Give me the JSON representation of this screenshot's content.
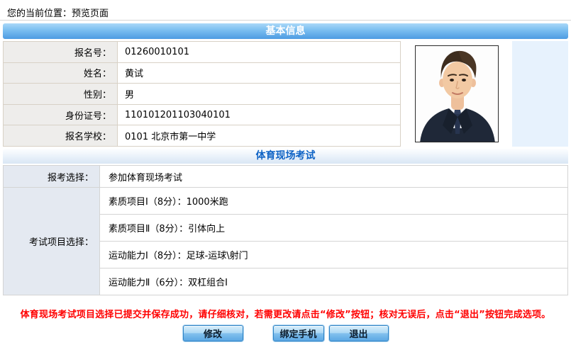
{
  "breadcrumb": {
    "text": "您的当前位置：预览页面"
  },
  "basic_info": {
    "header": "基本信息",
    "rows": [
      {
        "label": "报名号：",
        "value": "01260010101"
      },
      {
        "label": "姓名：",
        "value": "黄试"
      },
      {
        "label": "性别：",
        "value": "男"
      },
      {
        "label": "身份证号：",
        "value": "110101201103040101"
      },
      {
        "label": "报名学校：",
        "value": "0101 北京市第一中学"
      }
    ]
  },
  "exam": {
    "header": "体育现场考试",
    "choice_label": "报考选择：",
    "choice_value": "参加体育现场考试",
    "items_label": "考试项目选择：",
    "items": [
      "素质项目Ⅰ（8分）：1000米跑",
      "素质项目Ⅱ（8分）：引体向上",
      "运动能力Ⅰ（8分）：足球-运球\\射门",
      "运动能力Ⅱ（6分）：双杠组合Ⅰ"
    ]
  },
  "notice": "体育现场考试项目选择已提交并保存成功，请仔细核对，若需更改请点击“修改”按钮；核对无误后，点击“退出”按钮完成选项。",
  "buttons": {
    "modify": "修改",
    "bind_phone": "绑定手机",
    "exit": "退出"
  },
  "colors": {
    "header1_gradient_top": "#a9d8f8",
    "header1_gradient_bottom": "#4d9be2",
    "header1_text": "#ffffff",
    "header2_text": "#0f63c5",
    "label_bg_basic": "#eeedeb",
    "label_bg_exam": "#e4e9f1",
    "photo_panel_bg": "#e7f2fd",
    "notice_text": "#ff0000",
    "button_border": "#2f83c5"
  }
}
